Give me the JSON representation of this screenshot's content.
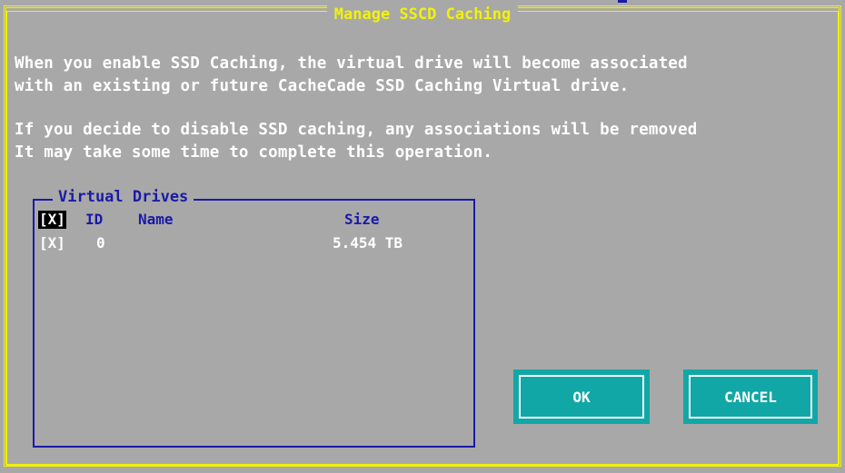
{
  "dialog": {
    "title": "Manage SSCD Caching",
    "messages": [
      "When you enable SSD Caching, the virtual drive will become associated",
      "with an existing or future CacheCade SSD Caching Virtual drive.",
      "If you decide to disable SSD caching, any associations will be removed",
      "It may take some time to complete this operation."
    ]
  },
  "virtual_drives": {
    "title": "Virtual Drives",
    "columns": {
      "check": "[X]",
      "id": "ID",
      "name": "Name",
      "size": "Size"
    },
    "rows": [
      {
        "check": "[X]",
        "id": "0",
        "name": "",
        "size": "5.454 TB"
      }
    ]
  },
  "buttons": {
    "ok": "OK",
    "cancel": "CANCEL"
  },
  "colors": {
    "background": "#a8a8a8",
    "border_yellow": "#f2f20a",
    "text_white": "#ffffff",
    "text_blue": "#1a1aa8",
    "button_teal": "#12a7a7"
  }
}
